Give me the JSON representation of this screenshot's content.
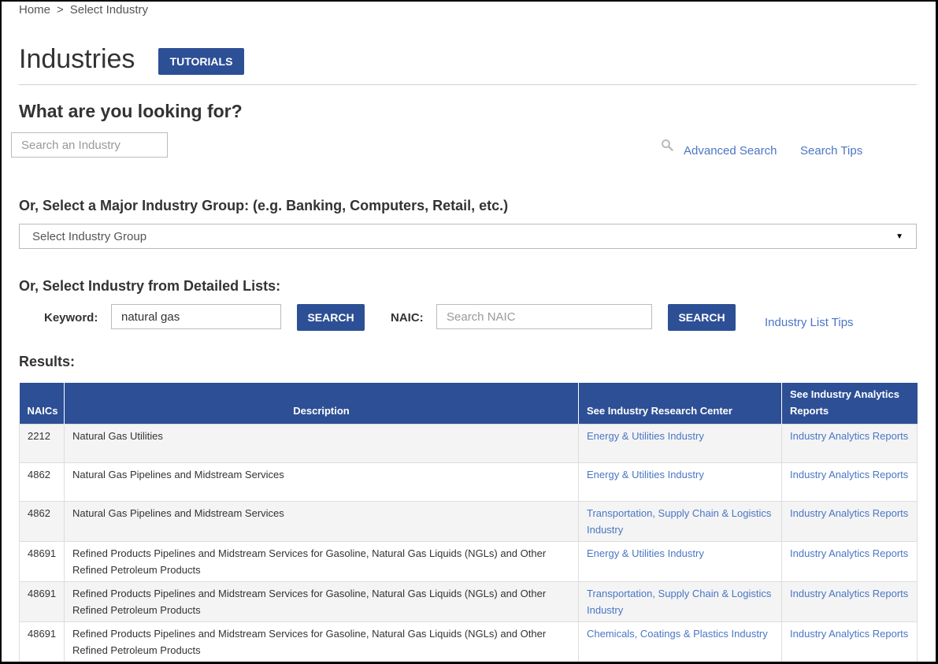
{
  "breadcrumb": {
    "home": "Home",
    "separator": ">",
    "current": "Select Industry"
  },
  "page": {
    "title": "Industries",
    "tutorials_label": "TUTORIALS"
  },
  "search": {
    "heading": "What are you looking for?",
    "placeholder": "Search an Industry",
    "advanced_label": "Advanced Search",
    "tips_label": "Search Tips"
  },
  "group": {
    "label": "Or, Select a Major Industry Group: (e.g. Banking, Computers, Retail, etc.)",
    "selected": "Select Industry Group"
  },
  "detailed": {
    "label": "Or, Select Industry from Detailed Lists:",
    "keyword_label": "Keyword:",
    "keyword_value": "natural gas",
    "search_label": "SEARCH",
    "naic_label": "NAIC:",
    "naic_placeholder": "Search NAIC",
    "tips_label": "Industry List Tips"
  },
  "results": {
    "label": "Results:",
    "headers": [
      "NAICs",
      "Description",
      "See Industry Research Center",
      "See Industry Analytics Reports"
    ],
    "rows": [
      {
        "naics": "2212",
        "description": "Natural Gas Utilities",
        "center": "Energy & Utilities Industry",
        "reports": "Industry Analytics Reports"
      },
      {
        "naics": "4862",
        "description": "Natural Gas Pipelines and Midstream Services",
        "center": "Energy & Utilities Industry",
        "reports": "Industry Analytics Reports"
      },
      {
        "naics": "4862",
        "description": "Natural Gas Pipelines and Midstream Services",
        "center": "Transportation, Supply Chain & Logistics Industry",
        "reports": "Industry Analytics Reports"
      },
      {
        "naics": "48691",
        "description": "Refined Products Pipelines and Midstream Services for Gasoline, Natural Gas Liquids (NGLs) and Other Refined Petroleum Products",
        "center": "Energy & Utilities Industry",
        "reports": "Industry Analytics Reports"
      },
      {
        "naics": "48691",
        "description": "Refined Products Pipelines and Midstream Services for Gasoline, Natural Gas Liquids (NGLs) and Other Refined Petroleum Products",
        "center": "Transportation, Supply Chain & Logistics Industry",
        "reports": "Industry Analytics Reports"
      },
      {
        "naics": "48691",
        "description": "Refined Products Pipelines and Midstream Services for Gasoline, Natural Gas Liquids (NGLs) and Other Refined Petroleum Products",
        "center": "Chemicals, Coatings & Plastics Industry",
        "reports": "Industry Analytics Reports"
      }
    ]
  }
}
